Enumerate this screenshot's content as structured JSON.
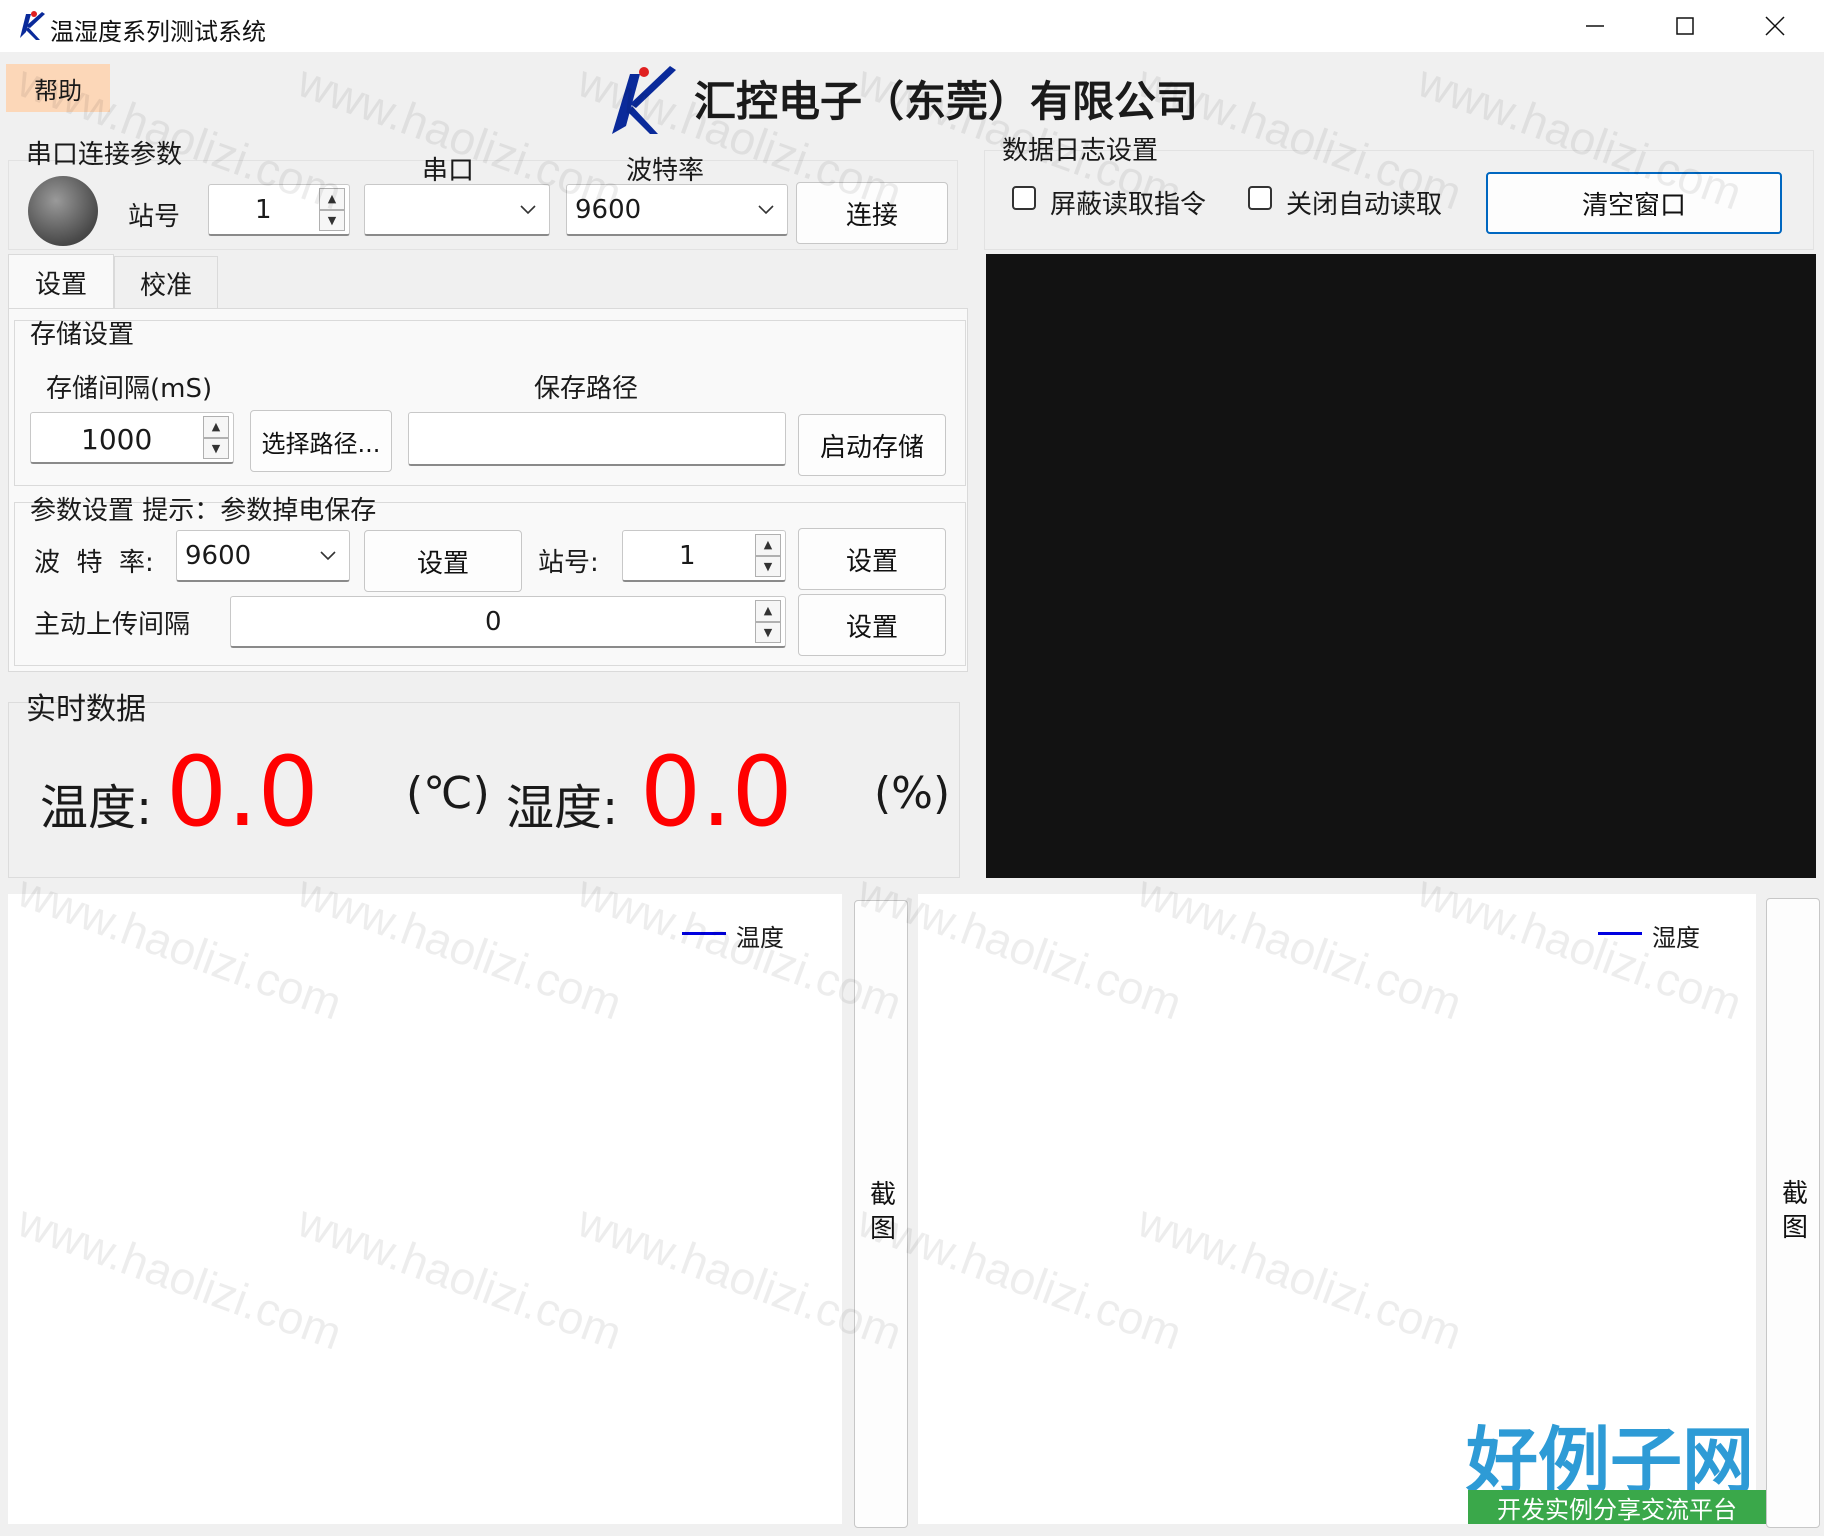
{
  "window": {
    "title": "温湿度系列测试系统",
    "controls": [
      "minimize-icon",
      "maximize-icon",
      "close-icon"
    ]
  },
  "menu": {
    "help_label": "帮助"
  },
  "header": {
    "company": "汇控电子（东莞）有限公司"
  },
  "serial": {
    "group_title": "串口连接参数",
    "station_label": "站号",
    "station_value": "1",
    "port_header": "串口",
    "port_value": "",
    "baud_header": "波特率",
    "baud_value": "9600",
    "connect_label": "连接"
  },
  "tabs": [
    {
      "label": "设置",
      "active": true
    },
    {
      "label": "校准",
      "active": false
    }
  ],
  "storage": {
    "section_title": "存储设置",
    "interval_label": "存储间隔(mS)",
    "interval_value": "1000",
    "path_header": "保存路径",
    "choose_path_label": "选择路径...",
    "path_value": "",
    "start_label": "启动存储"
  },
  "params": {
    "section_title": "参数设置 提示：参数掉电保存",
    "baud_label": "波  特  率:",
    "baud_value": "9600",
    "baud_set_label": "设置",
    "station_label": "站号:",
    "station_value": "1",
    "station_set_label": "设置",
    "upload_label": "主动上传间隔",
    "upload_value": "0",
    "upload_set_label": "设置"
  },
  "realtime": {
    "section_title": "实时数据",
    "temp_label": "温度:",
    "temp_value": "0.0",
    "temp_unit": "(℃)",
    "hum_label": "湿度:",
    "hum_value": "0.0",
    "hum_unit": "(%)",
    "value_color": "#ff0000"
  },
  "log": {
    "group_title": "数据日志设置",
    "mask_read_label": "屏蔽读取指令",
    "mask_read_checked": false,
    "auto_read_off_label": "关闭自动读取",
    "auto_read_off_checked": false,
    "clear_label": "清空窗口",
    "console_bg": "#121212"
  },
  "charts": [
    {
      "legend": "温度",
      "screenshot_label": "截图",
      "line_color": "#0000e0"
    },
    {
      "legend": "湿度",
      "screenshot_label": "截图",
      "line_color": "#0000e0"
    }
  ],
  "watermark": {
    "text": "www.haolizi.com",
    "badge_title": "好例子网",
    "badge_subtitle": "开发实例分享交流平台"
  }
}
